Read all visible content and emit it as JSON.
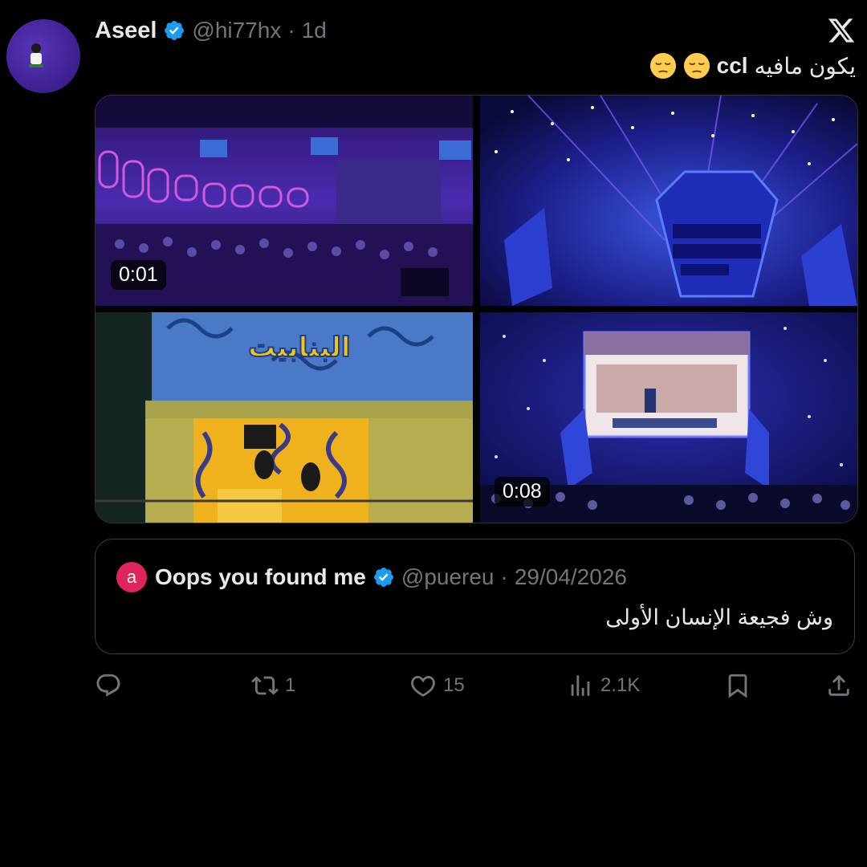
{
  "tweet": {
    "author_name": "Aseel",
    "author_handle": "@hi77hx",
    "separator": "·",
    "time": "1d",
    "text_arabic": "يكون مافيه",
    "text_brand": "ccl",
    "emojis": [
      "pensive-face",
      "pensive-face"
    ]
  },
  "media": {
    "tiles": [
      {
        "name": "arena-crowd",
        "duration": "0:01"
      },
      {
        "name": "stage-starting-soon",
        "duration": ""
      },
      {
        "name": "booth-yellow-penguins",
        "duration": ""
      },
      {
        "name": "big-screen-game",
        "duration": "0:08"
      }
    ]
  },
  "quote": {
    "avatar_letter": "a",
    "author_name": "Oops you found me",
    "author_handle": "@puereu",
    "separator": "·",
    "date": "29/04/2026",
    "text": "وش فجيعة الإنسان الأولى"
  },
  "actions": {
    "reply_count": "",
    "repost_count": "1",
    "like_count": "15",
    "views_count": "2.1K"
  },
  "colors": {
    "background": "#000000",
    "primary_text": "#e7e9ea",
    "secondary_text": "#71767b",
    "verified": "#1d9bf0",
    "quote_avatar": "#e0245e"
  }
}
